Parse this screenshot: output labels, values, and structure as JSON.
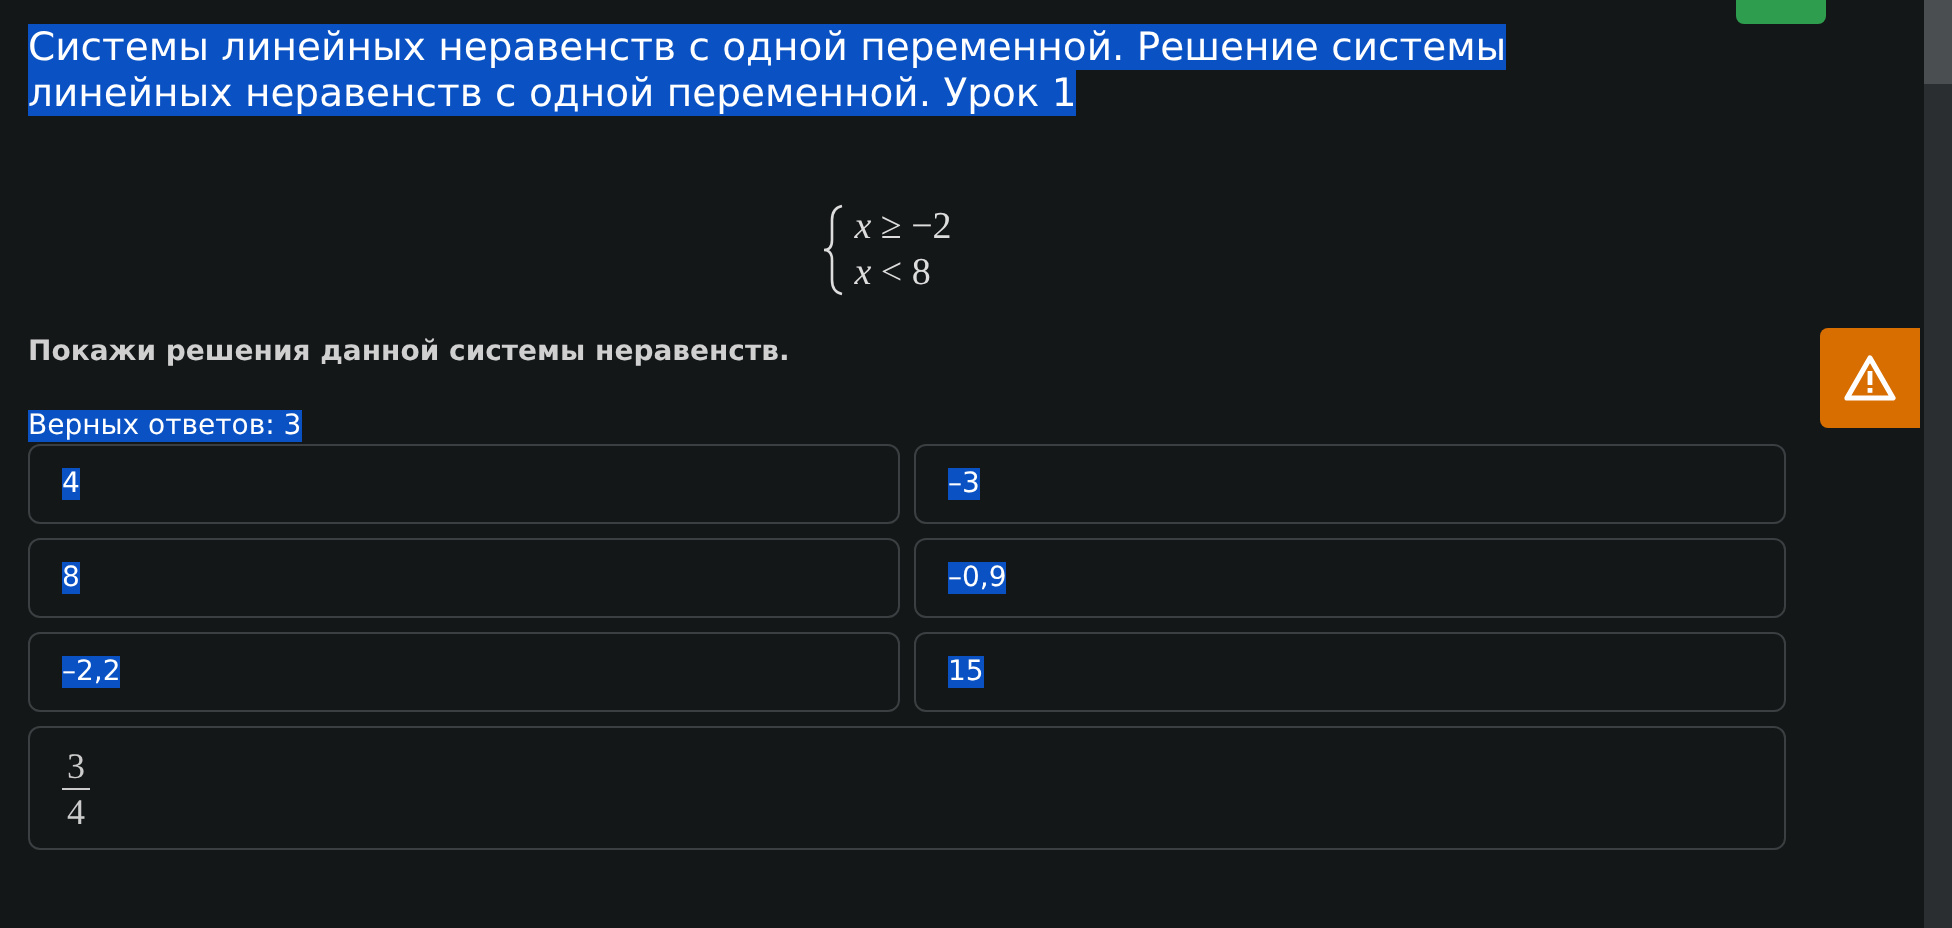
{
  "title": {
    "text": "Системы линейных неравенств с одной переменной. Решение системы линейных неравенств с одной переменной. Урок 1",
    "highlighted": true
  },
  "system": [
    {
      "lhs": "x",
      "op": "≥",
      "rhs": "−2"
    },
    {
      "lhs": "x",
      "op": "<",
      "rhs": "8"
    }
  ],
  "question": "Покажи решения данной системы неравенств.",
  "correct_count": {
    "text": "Верных ответов: 3",
    "highlighted": true
  },
  "options": [
    {
      "kind": "text",
      "text": "4",
      "highlighted": true
    },
    {
      "kind": "text",
      "text": "–3",
      "highlighted": true
    },
    {
      "kind": "text",
      "text": "8",
      "highlighted": true
    },
    {
      "kind": "text",
      "text": "–0,9",
      "highlighted": true
    },
    {
      "kind": "text",
      "text": "–2,2",
      "highlighted": true
    },
    {
      "kind": "text",
      "text": "15",
      "highlighted": true
    },
    {
      "kind": "fraction",
      "numerator": "3",
      "denominator": "4",
      "highlighted": false
    }
  ]
}
